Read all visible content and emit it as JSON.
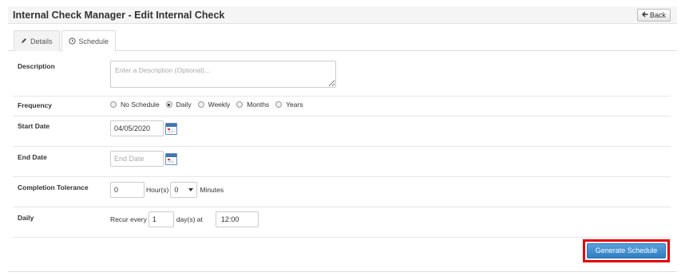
{
  "header": {
    "title": "Internal Check Manager - Edit Internal Check",
    "back_label": "Back",
    "back_icon": "arrow-left-icon"
  },
  "tabs": [
    {
      "label": "Details",
      "icon": "pencil-icon",
      "active": false
    },
    {
      "label": "Schedule",
      "icon": "clock-icon",
      "active": true
    }
  ],
  "form": {
    "description": {
      "label": "Description",
      "value": "",
      "placeholder": "Enter a Description (Optional)..."
    },
    "frequency": {
      "label": "Frequency",
      "options": [
        "No Schedule",
        "Daily",
        "Weekly",
        "Months",
        "Years"
      ],
      "selected": "Daily"
    },
    "start_date": {
      "label": "Start Date",
      "value": "04/05/2020",
      "placeholder": ""
    },
    "end_date": {
      "label": "End Date",
      "value": "",
      "placeholder": "End Date"
    },
    "completion_tolerance": {
      "label": "Completion Tolerance",
      "hours_value": "0",
      "hours_unit": "Hour(s)",
      "minutes_value": "0",
      "minutes_unit": "Minutes"
    },
    "daily": {
      "label": "Daily",
      "recur_prefix": "Recur every",
      "recur_value": "1",
      "recur_suffix": "day(s) at",
      "time_value": "12:00"
    }
  },
  "actions": {
    "generate_label": "Generate Schedule"
  },
  "colors": {
    "primary_button": "#2f7ec2",
    "highlight_border": "#e00000",
    "calendar_accent": "#3f76b5"
  }
}
